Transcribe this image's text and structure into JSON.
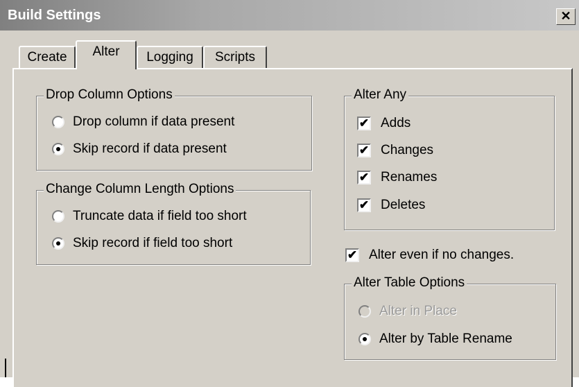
{
  "window": {
    "title": "Build Settings",
    "close_label": "✕"
  },
  "tabs": [
    {
      "label": "Create",
      "active": false
    },
    {
      "label": "Alter",
      "active": true
    },
    {
      "label": "Logging",
      "active": false
    },
    {
      "label": "Scripts",
      "active": false
    }
  ],
  "drop_column_options": {
    "title": "Drop Column Options",
    "options": [
      {
        "label": "Drop column if data present",
        "selected": false
      },
      {
        "label": "Skip record if data present",
        "selected": true
      }
    ]
  },
  "change_column_length_options": {
    "title": "Change Column Length Options",
    "options": [
      {
        "label": "Truncate data if field too short",
        "selected": false
      },
      {
        "label": "Skip record if field too short",
        "selected": true
      }
    ]
  },
  "alter_any": {
    "title": "Alter Any",
    "items": [
      {
        "label": "Adds",
        "checked": true
      },
      {
        "label": "Changes",
        "checked": true
      },
      {
        "label": "Renames",
        "checked": true
      },
      {
        "label": "Deletes",
        "checked": true
      }
    ]
  },
  "alter_even": {
    "label": "Alter even if no changes.",
    "checked": true
  },
  "alter_table_options": {
    "title": "Alter Table Options",
    "options": [
      {
        "label": "Alter in Place",
        "selected": false,
        "disabled": true
      },
      {
        "label": "Alter by Table Rename",
        "selected": true,
        "disabled": false
      }
    ]
  },
  "check_mark": "✔"
}
